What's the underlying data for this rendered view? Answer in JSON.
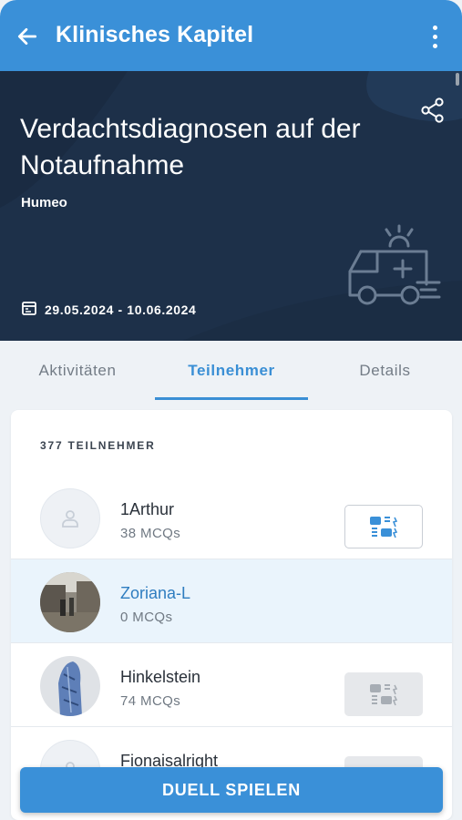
{
  "appbar": {
    "title": "Klinisches Kapitel",
    "back_icon": "arrow-left-icon",
    "menu_icon": "more-vertical-icon"
  },
  "hero": {
    "title": "Verdachtsdiagnosen auf der Notaufnahme",
    "author": "Humeo",
    "date_range": "29.05.2024 - 10.06.2024",
    "date_icon": "calendar-icon",
    "share_icon": "share-icon",
    "illustration_icon": "ambulance-icon"
  },
  "tabs": {
    "items": [
      {
        "label": "Aktivitäten",
        "active": false
      },
      {
        "label": "Teilnehmer",
        "active": true
      },
      {
        "label": "Details",
        "active": false
      }
    ]
  },
  "participants": {
    "count_label": "377 TEILNEHMER",
    "items": [
      {
        "name": "1Arthur",
        "mcqs": "38 MCQs",
        "avatar": "placeholder",
        "duel": "enabled"
      },
      {
        "name": "Zoriana-L",
        "mcqs": "0 MCQs",
        "avatar": "photo",
        "duel": "none"
      },
      {
        "name": "Hinkelstein",
        "mcqs": "74 MCQs",
        "avatar": "photo",
        "duel": "disabled"
      },
      {
        "name": "Fionaisalright",
        "mcqs": "",
        "avatar": "placeholder",
        "duel": "disabled"
      }
    ]
  },
  "cta": {
    "label": "DUELL SPIELEN"
  },
  "colors": {
    "primary": "#3a90d8",
    "hero_bg": "#1d3049",
    "link": "#2f7dc0",
    "highlight_row": "#eaf4fc"
  }
}
